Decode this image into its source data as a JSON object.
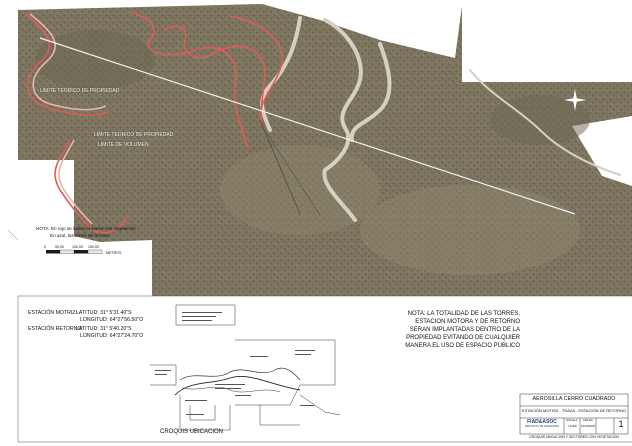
{
  "map": {
    "labels": {
      "upper_left": "LIMITE TEORICO DE PROPIEDAD",
      "center_1": "LIMITE TEORICO DE PROPIEDAD",
      "center_2": "LIMITE DE VOLUMEN"
    },
    "scale_bar": {
      "ticks": [
        "0",
        "50,00",
        "100,00",
        "150,00"
      ],
      "unit": "METROS"
    },
    "map_note": "NOTA: En rojo se indica el sector con vegetacion",
    "map_note_2": "En azul, las torres de la linea"
  },
  "coordinates": {
    "motriz_label": "ESTACIÓN MOTRIZ:",
    "motriz_lat": "LATITUD:   31° 5'31.40\"S",
    "motriz_lon": "LONGITUD: 64°27'56.50\"O",
    "retorno_label": "ESTACIÓN RETORNO:",
    "retorno_lat": "LATITUD:   31° 5'40.20\"S",
    "retorno_lon": "LONGITUD: 64°27'24.70\"O"
  },
  "note": {
    "line1": "NOTA: LA TOTALIDAD DE LAS TORRES,",
    "line2": "ESTACION MOTORA Y DE RETORNO",
    "line3": "SERAN IMPLANTADAS DENTRO DE LA",
    "line4": "PROPIEDAD EVITANDO DE CUALQUIER",
    "line5": "MANERA EL USO DE ESPACIO PUBLICO"
  },
  "croquis": {
    "title": "CROQUIS UBICACION"
  },
  "title_block": {
    "project": "AEROSILLA CERRO CUADRADO",
    "subtitle": "ESTACIÓN MOTRIZ - TRAZA - ESTACIÓN DE RETORNO",
    "firm": "FIAD&ASOC",
    "firm_sub": "SERVICIOS DE INGENIERIA",
    "drawing": "CROQUIS UBICACION Y SECTORES CON VEGETACION",
    "scale_label": "ESCALA",
    "scale_value": "1:1000",
    "date_label": "FECHA",
    "date_value": "14/03/2023",
    "sheet": "1"
  },
  "colors": {
    "terrain": "#7f7761",
    "road": "#d8d2c3",
    "vegetation_border": "#e05a55",
    "profile_line": "#ededed"
  }
}
